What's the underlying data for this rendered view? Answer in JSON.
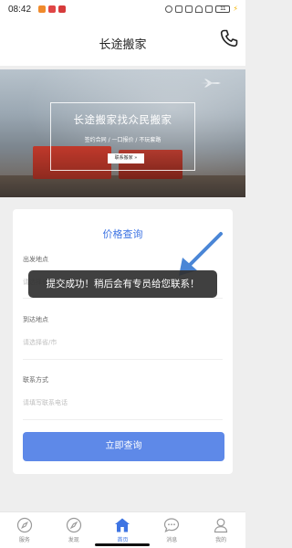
{
  "status_bar": {
    "time": "08:42",
    "battery": "11",
    "left_icons": [
      "app-icon-orange",
      "app-icon-red",
      "app-icon-red"
    ],
    "right_icons": [
      "alarm-icon",
      "vibrate-icon",
      "hd-icon",
      "wifi-icon",
      "signal-icon"
    ]
  },
  "header": {
    "title": "长途搬家",
    "phone_icon": "phone-icon"
  },
  "banner": {
    "title": "长途搬家找众民搬家",
    "subtitle": "签约合同 / 一口报价 / 不玩套路",
    "button": "联系搬家 »"
  },
  "form": {
    "title": "价格查询",
    "fields": [
      {
        "label": "出发地点",
        "placeholder": "请选择省/市"
      },
      {
        "label": "到达地点",
        "placeholder": "请选择省/市"
      },
      {
        "label": "联系方式",
        "placeholder": "请填写联系电话"
      }
    ],
    "submit": "立即查询"
  },
  "toast": {
    "message": "提交成功！稍后会有专员给您联系！"
  },
  "bottom_nav": {
    "items": [
      {
        "label": "服务",
        "icon": "compass-icon",
        "active": false
      },
      {
        "label": "发现",
        "icon": "discover-icon",
        "active": false
      },
      {
        "label": "首页",
        "icon": "home-icon",
        "active": true
      },
      {
        "label": "消息",
        "icon": "chat-icon",
        "active": false
      },
      {
        "label": "我的",
        "icon": "user-icon",
        "active": false
      }
    ]
  },
  "colors": {
    "accent": "#3e74e3",
    "button": "#5e89e8",
    "toast_bg": "#303030",
    "annotation_arrow": "#4a86d6"
  }
}
